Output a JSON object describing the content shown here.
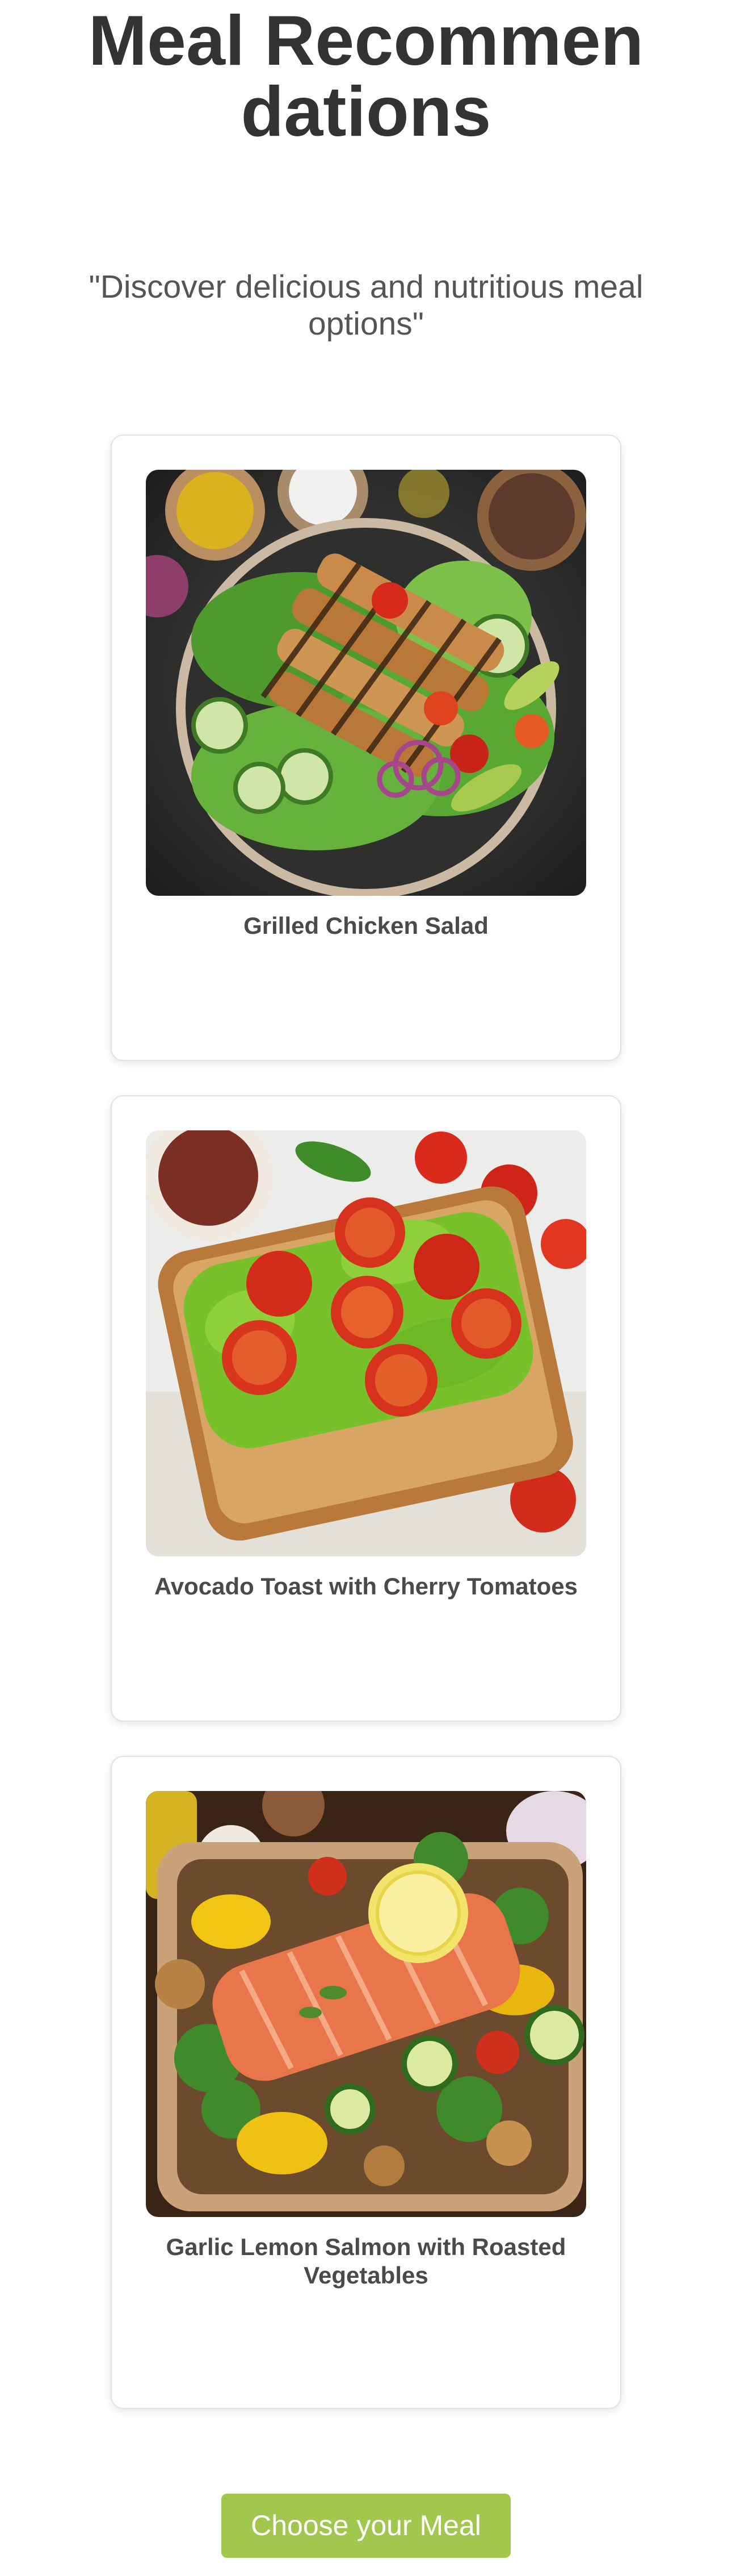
{
  "page": {
    "title": "Meal Recommendations",
    "subtitle": "\"Discover delicious and nutritious meal options\""
  },
  "meals": [
    {
      "name": "Grilled Chicken Salad",
      "image_icon": "grilled-chicken-salad-photo"
    },
    {
      "name": "Avocado Toast with Cherry Tomatoes",
      "image_icon": "avocado-toast-photo"
    },
    {
      "name": "Garlic Lemon Salmon with Roasted Vegetables",
      "image_icon": "salmon-vegetables-photo"
    }
  ],
  "cta": {
    "label": "Choose your Meal"
  },
  "colors": {
    "accent": "#a1c74f",
    "title": "#333333",
    "subtitle": "#555555",
    "card_border": "#e2e2e2"
  }
}
